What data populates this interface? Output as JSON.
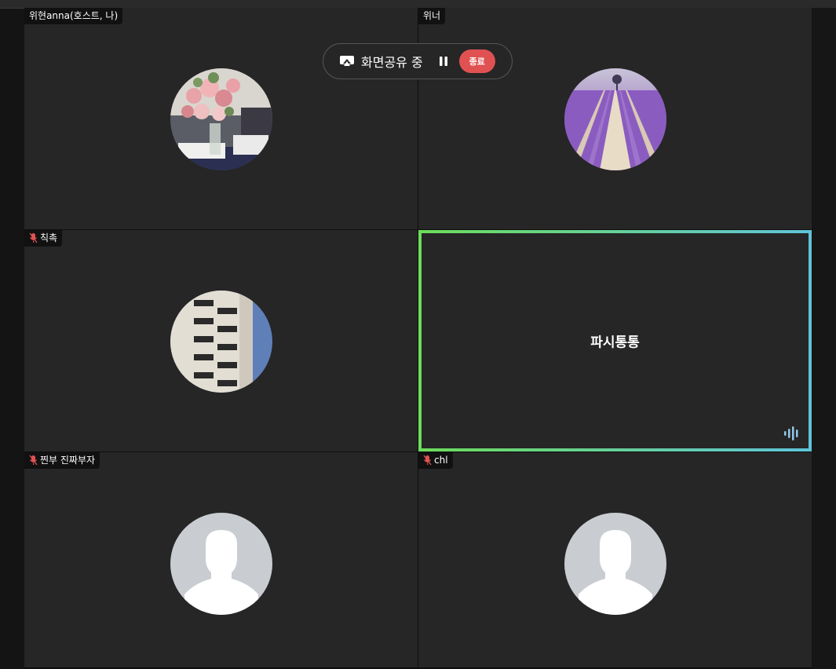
{
  "screen_share": {
    "status_label": "화면공유 중",
    "stop_label": "종료"
  },
  "participants": [
    {
      "name": "위현anna(호스트, 나)",
      "muted": false,
      "avatar": "flowers-photo"
    },
    {
      "name": "위너",
      "muted": false,
      "avatar": "lavender-field-photo"
    },
    {
      "name": "칙촉",
      "muted": true,
      "avatar": "building-photo"
    },
    {
      "name": "파시통통",
      "muted": false,
      "avatar": null,
      "speaking": true
    },
    {
      "name": "찐부 진짜부자",
      "muted": true,
      "avatar": "default-silhouette"
    },
    {
      "name": "chl",
      "muted": true,
      "avatar": "default-silhouette"
    }
  ],
  "colors": {
    "active_border_start": "#6cdc5a",
    "active_border_end": "#5fc4d9",
    "stop_button": "#e05252",
    "muted_mic": "#e05252"
  }
}
